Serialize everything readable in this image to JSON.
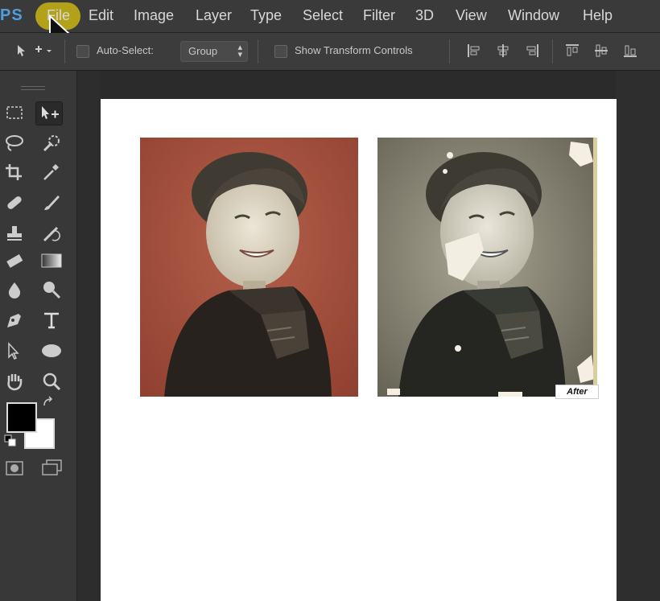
{
  "app": {
    "logo": "PS"
  },
  "menu": {
    "items": [
      "File",
      "Edit",
      "Image",
      "Layer",
      "Type",
      "Select",
      "Filter",
      "3D",
      "View",
      "Window",
      "Help"
    ]
  },
  "options": {
    "auto_select_label": "Auto-Select:",
    "group_value": "Group",
    "show_transform_label": "Show Transform Controls"
  },
  "canvas": {
    "after_label": "After"
  },
  "colors": {
    "accent": "#4f9fe0",
    "highlight": "#c8b414",
    "foreground": "#000000",
    "background": "#ffffff"
  },
  "tools": [
    "move-tool",
    "marquee-tool",
    "artboard-tool",
    "lasso-tool",
    "quick-selection-tool",
    "crop-tool",
    "eyedropper-tool",
    "spot-healing-tool",
    "brush-tool",
    "clone-stamp-tool",
    "history-brush-tool",
    "eraser-tool",
    "gradient-tool",
    "blur-tool",
    "dodge-tool",
    "pen-tool",
    "type-tool",
    "path-selection-tool",
    "ellipse-tool",
    "hand-tool",
    "zoom-tool"
  ]
}
